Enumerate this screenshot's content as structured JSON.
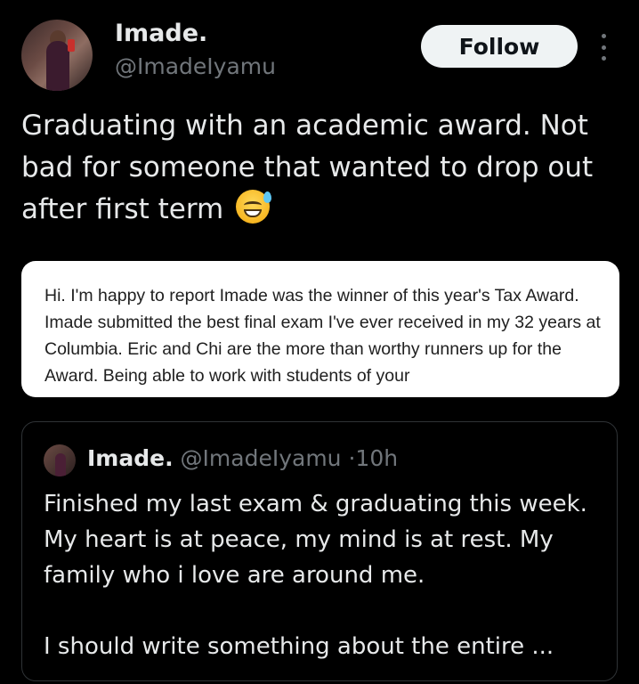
{
  "tweet": {
    "author_name": "Imade.",
    "author_handle": "@ImadeIyamu",
    "follow_label": "Follow",
    "text": "Graduating with an academic award. Not bad for someone that wanted to drop out after first term",
    "emoji": "grinning-face-with-sweat",
    "image_text": "Hi. I'm happy to report Imade was the winner of this year's Tax Award. Imade submitted the best final exam I've ever received in my 32 years at Columbia. Eric and Chi are the more than worthy runners up for the Award. Being able to work with students of your"
  },
  "quoted": {
    "author_name": "Imade.",
    "author_handle": "@ImadeIyamu",
    "separator": "·",
    "time": "10h",
    "text": "Finished my last exam & graduating this week. My heart is at peace, my mind is at rest. My family who i love are around me.\n\nI should write something about the entire ..."
  },
  "icons": {
    "more": "more-vertical-icon"
  }
}
